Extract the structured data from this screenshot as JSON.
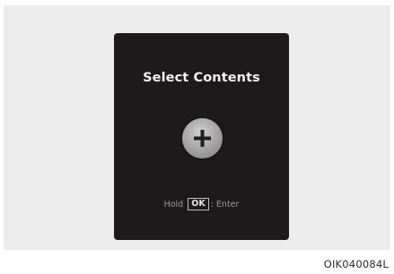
{
  "screen": {
    "title": "Select Contents",
    "hint": {
      "hold_label": "Hold",
      "key_label": "OK",
      "separator": ":",
      "action_label": "Enter"
    },
    "add_icon": "plus-icon"
  },
  "figure_code": "OIK040084L",
  "colors": {
    "screen_background": "#1c1a1b",
    "panel_background": "#ececec",
    "title_text": "#f2f2f2",
    "button_fill": "#a9a9a9"
  }
}
